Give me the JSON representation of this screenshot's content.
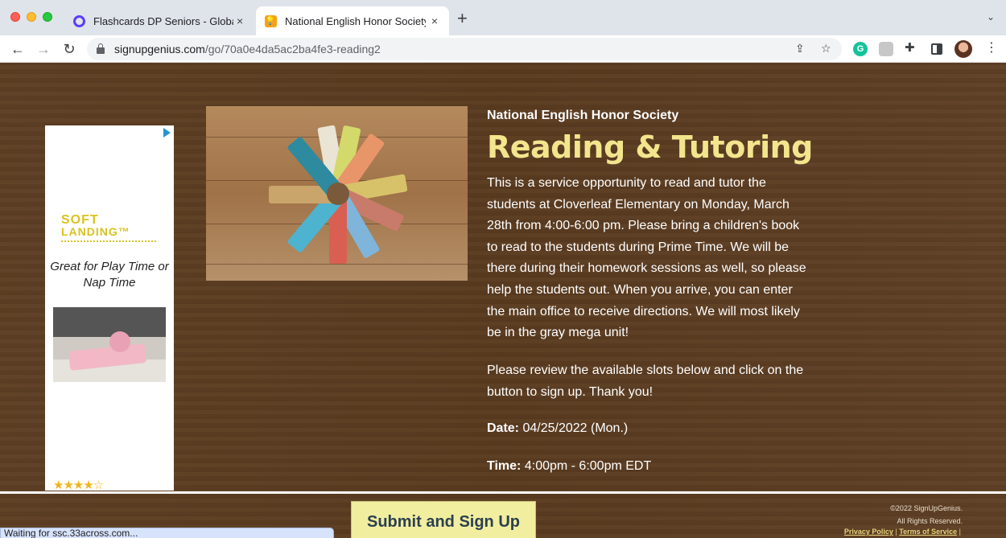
{
  "browser": {
    "tabs": [
      {
        "title": "Flashcards DP Seniors - Global",
        "close": "×"
      },
      {
        "title": "National English Honor Society",
        "close": "×"
      }
    ],
    "new_tab": "+",
    "tab_menu": "⌄",
    "url_domain": "signupgenius.com",
    "url_path": "/go/70a0e4da5ac2ba4fe3-reading2",
    "extension_grammarly": "G"
  },
  "ad": {
    "logo_line1": "SOFT",
    "logo_line2": "LANDING",
    "tm": "™",
    "tagline": "Great for Play Time or Nap Time",
    "stars": "★★★★☆"
  },
  "event": {
    "org": "National English Honor Society",
    "title": "Reading & Tutoring",
    "description": "This is a service opportunity to read and tutor the students at Cloverleaf Elementary on Monday, March 28th from 4:00-6:00 pm. Please bring a children's book to read to the students during Prime Time. We will be there during their homework sessions as well, so please help the students out. When you arrive, you can enter the main office to receive directions. We will most likely be in the gray mega unit!",
    "review": "Please review the available slots below and click on the button to sign up. Thank you!",
    "date_label": "Date:",
    "date_value": "04/25/2022 (Mon.)",
    "time_label": "Time:",
    "time_value": "4:00pm - 6:00pm EDT"
  },
  "footer": {
    "submit_label": "Submit and Sign Up",
    "copyright": "©2022 SignUpGenius.",
    "rights": "All Rights Reserved.",
    "privacy": "Privacy Policy",
    "terms": "Terms of Service",
    "separator": "|"
  },
  "status_text": "Waiting for ssc.33across.com..."
}
